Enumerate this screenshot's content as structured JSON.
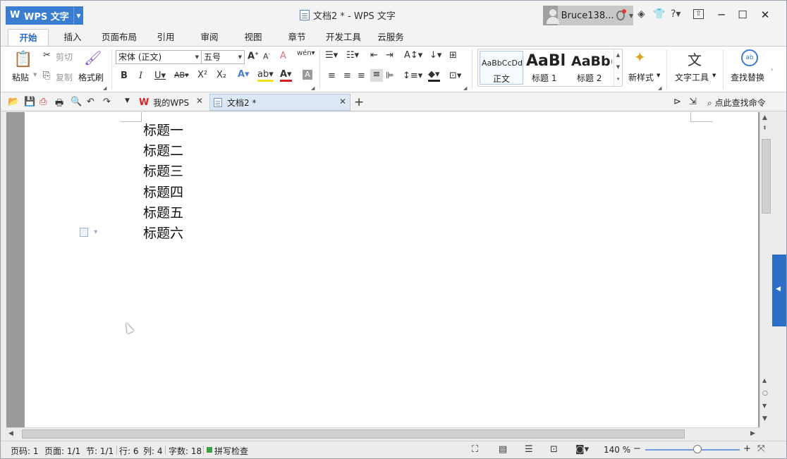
{
  "titlebar": {
    "app_button": "WPS 文字",
    "window_title": "文档2 * - WPS 文字",
    "user_name": "Bruce138...",
    "controls": {
      "minimize": "─",
      "maximize": "☐",
      "close": "✕"
    }
  },
  "ribbon_tabs": [
    "开始",
    "插入",
    "页面布局",
    "引用",
    "审阅",
    "视图",
    "章节",
    "开发工具",
    "云服务"
  ],
  "ribbon": {
    "paste": "粘贴",
    "cut": "剪切",
    "copy": "复制",
    "format_painter": "格式刷",
    "font_name": "宋体 (正文)",
    "font_size": "五号",
    "styles": [
      {
        "preview": "AaBbCcDd",
        "name": "正文"
      },
      {
        "preview": "AaBl",
        "name": "标题 1"
      },
      {
        "preview": "AaBb(",
        "name": "标题 2"
      }
    ],
    "new_style": "新样式",
    "text_tools": "文字工具",
    "find_replace": "查找替换"
  },
  "doc_tabs": [
    {
      "label": "我的WPS"
    },
    {
      "label": "文档2 *"
    }
  ],
  "search_command": "点此查找命令",
  "document": {
    "lines": [
      "标题一",
      "标题二",
      "标题三",
      "标题四",
      "标题五",
      "标题六"
    ]
  },
  "status": {
    "page_num": "页码: 1",
    "pages": "页面: 1/1",
    "section": "节: 1/1",
    "row": "行: 6",
    "col": "列: 4",
    "word_count": "字数: 18",
    "spell_check": "拼写检查",
    "zoom": "140 %"
  },
  "colors": {
    "accent": "#3b7ed1",
    "side_tab": "#2f6ec7",
    "active_tab_text": "#2a68c8"
  }
}
